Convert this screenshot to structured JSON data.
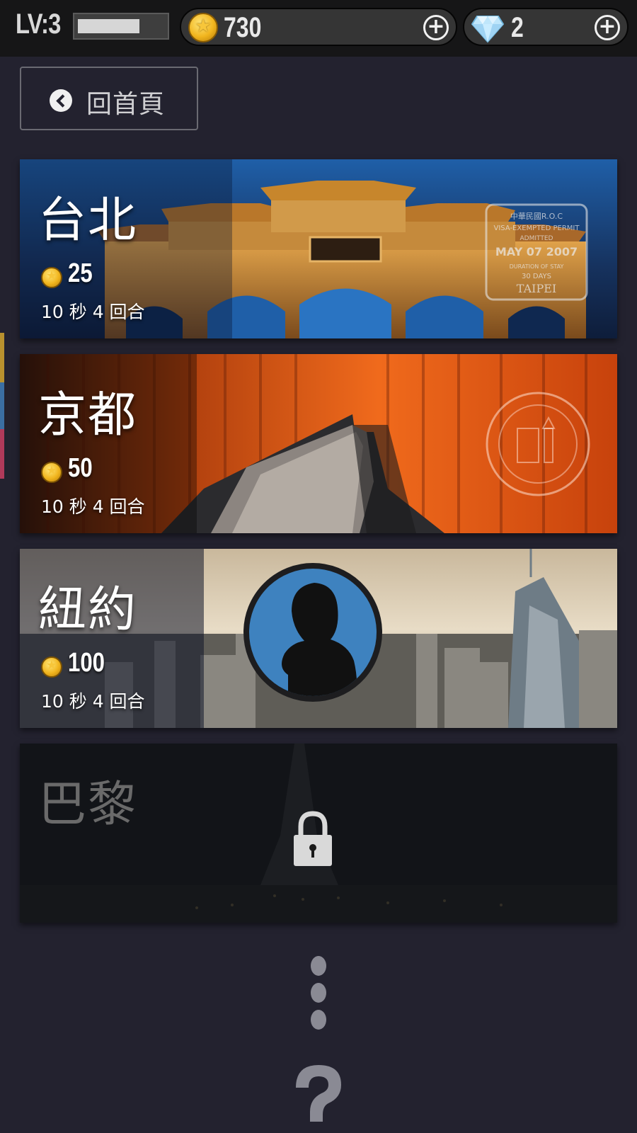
{
  "header": {
    "level": "LV:3",
    "xp_progress": 0.7,
    "coins": "730",
    "gems": "2"
  },
  "back": {
    "label": "回首頁"
  },
  "cities": [
    {
      "name": "台北",
      "cost": "25",
      "rule": "10 秒 4 回合",
      "locked": false
    },
    {
      "name": "京都",
      "cost": "50",
      "rule": "10 秒 4 回合",
      "locked": false
    },
    {
      "name": "紐約",
      "cost": "100",
      "rule": "10 秒 4 回合",
      "locked": false
    },
    {
      "name": "巴黎",
      "locked": true
    }
  ],
  "stamps": {
    "taipei": [
      "中華民國R.O.C",
      "VISA-EXEMPTED PERMIT",
      "ADMITTED",
      "MAY 07 2007",
      "DURATION OF STAY",
      "30 DAYS",
      "TAIPEI"
    ]
  },
  "icons": {
    "coin": "coin-icon",
    "gem": "gem-icon",
    "plus": "plus-icon",
    "back": "chevron-left-icon",
    "lock": "lock-icon",
    "more": "ellipsis-vertical-icon",
    "mystery": "question-mark-icon"
  },
  "colors": {
    "background": "#23222f",
    "topbar": "#161617",
    "coin": "#f1b51e",
    "avatar": "#3e82bf"
  }
}
